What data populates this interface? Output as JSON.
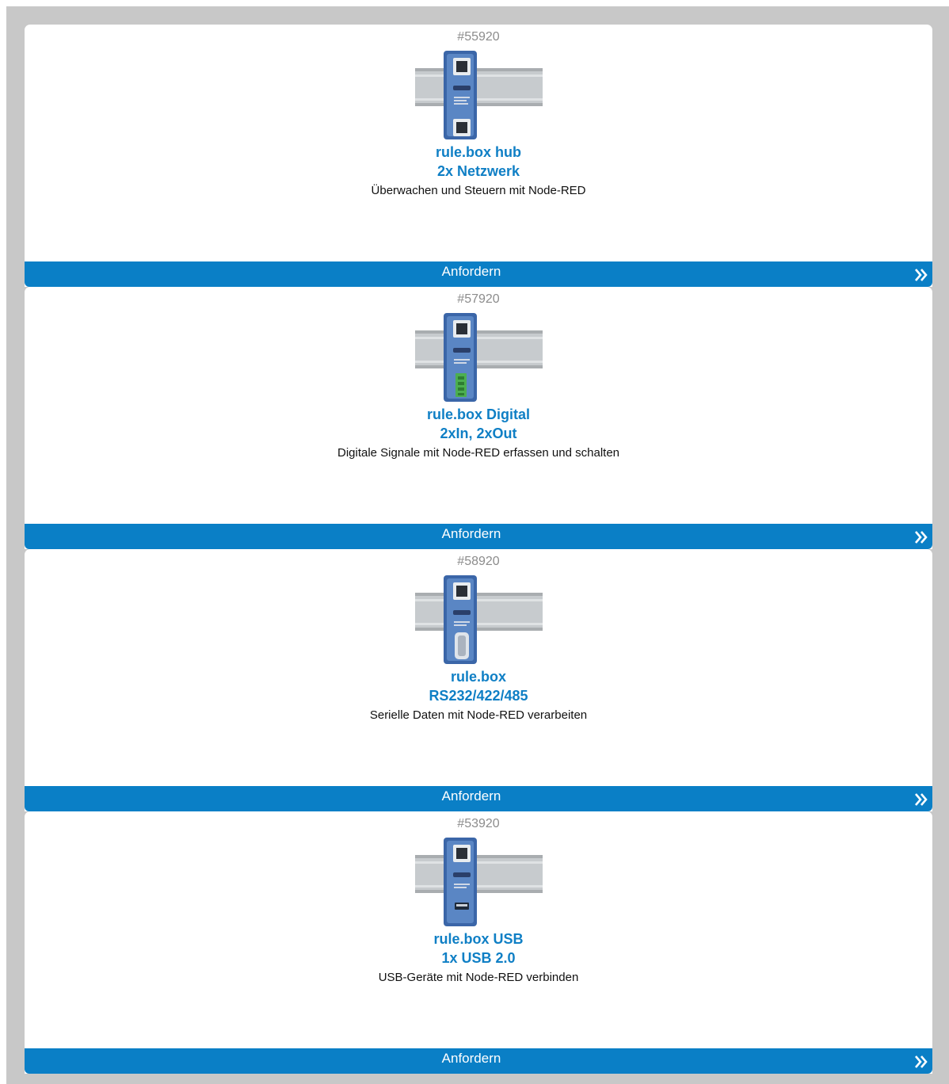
{
  "products": [
    {
      "article_no": "#55920",
      "title_line1": "rule.box hub",
      "title_line2": "2x Netzwerk",
      "description": "Überwachen und Steuern mit Node-RED",
      "button_label": "Anfordern",
      "variant": "hub"
    },
    {
      "article_no": "#57920",
      "title_line1": "rule.box Digital",
      "title_line2": "2xIn, 2xOut",
      "description": "Digitale Signale mit Node-RED erfassen und schalten",
      "button_label": "Anfordern",
      "variant": "digital"
    },
    {
      "article_no": "#58920",
      "title_line1": "rule.box",
      "title_line2": "RS232/422/485",
      "description": "Serielle Daten mit Node-RED verarbeiten",
      "button_label": "Anfordern",
      "variant": "serial"
    },
    {
      "article_no": "#53920",
      "title_line1": "rule.box USB",
      "title_line2": "1x USB 2.0",
      "description": "USB-Geräte mit Node-RED verbinden",
      "button_label": "Anfordern",
      "variant": "usb"
    }
  ],
  "colors": {
    "accent": "#0a7fc6",
    "title": "#0f7fc5",
    "article_no": "#8c8c8c",
    "background": "#c8c8c8"
  }
}
